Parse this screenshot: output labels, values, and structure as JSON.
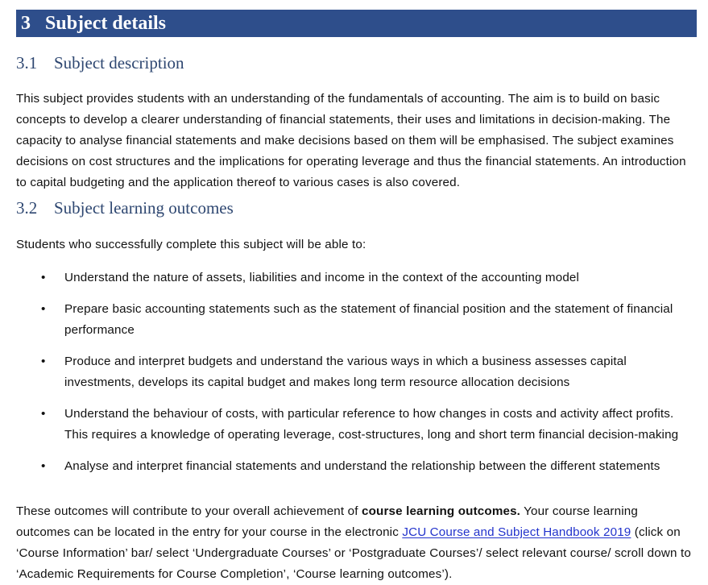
{
  "chapter": {
    "number": "3",
    "title": "Subject details"
  },
  "sections": {
    "description": {
      "number": "3.1",
      "title": "Subject description",
      "paragraph": "This subject provides students with an understanding of the fundamentals of accounting. The aim is to build on basic concepts to develop a clearer understanding of financial statements, their uses and limitations in decision-making. The capacity to analyse financial statements and make decisions based on them will be emphasised. The subject examines decisions on cost structures and the implications for operating leverage and thus the financial statements. An introduction to capital budgeting and the application thereof to various cases is also covered."
    },
    "learning_outcomes": {
      "number": "3.2",
      "title": "Subject learning outcomes",
      "intro": "Students who successfully complete this subject will be able to:",
      "bullet_glyph": "•",
      "items": [
        "Understand the nature of assets, liabilities and income in the context of the accounting model",
        "Prepare basic accounting statements such as the statement of financial position and the statement of financial performance",
        "Produce and interpret budgets and understand the various ways in which a business assesses capital investments, develops its capital budget and makes long term resource allocation decisions",
        "Understand the behaviour of costs, with particular reference to how changes in costs and activity affect profits. This requires a knowledge of operating leverage, cost-structures, long and short term financial decision-making",
        "Analyse and interpret financial statements and understand  the relationship between the different statements"
      ],
      "closing_paragraph": {
        "part1": "These outcomes will contribute to your overall achievement of ",
        "bold_phrase": "course learning outcomes.",
        "part2": " Your course learning outcomes can be located in the entry for your course in the electronic ",
        "link_text": "JCU Course and Subject Handbook 2019",
        "part3": " (click on ‘Course Information’ bar/ select ‘Undergraduate Courses’ or ‘Postgraduate Courses’/ select relevant course/ scroll down to ‘Academic Requirements for Course Completion’, ‘Course learning outcomes’)."
      }
    }
  },
  "colors": {
    "banner_background": "#2E4E8B",
    "banner_text": "#FFFFFF",
    "heading_text": "#2E4771",
    "body_text": "#111111",
    "link": "#2233CC"
  }
}
